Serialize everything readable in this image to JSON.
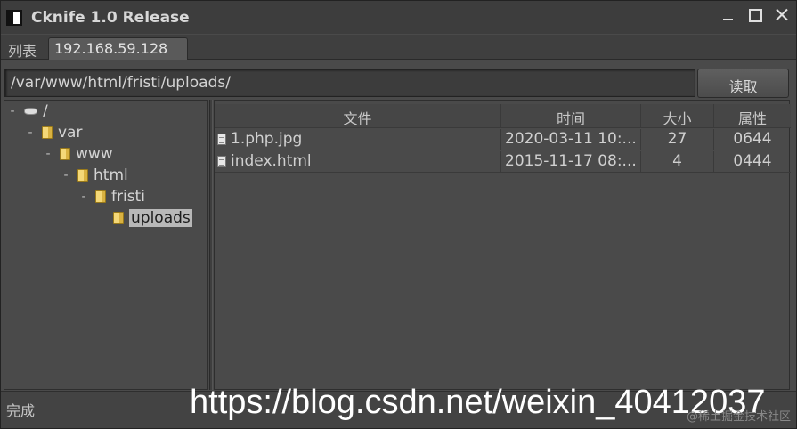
{
  "window": {
    "title": "Cknife 1.0 Release"
  },
  "tabs": [
    {
      "label": "列表"
    },
    {
      "label": "192.168.59.128"
    }
  ],
  "path_bar": {
    "value": "/var/www/html/fristi/uploads/",
    "read_button_label": "读取"
  },
  "tree": {
    "nodes": [
      {
        "label": "/",
        "toggle": "-",
        "icon": "drive-icon"
      },
      {
        "label": "var",
        "toggle": "-",
        "icon": "folder-icon"
      },
      {
        "label": "www",
        "toggle": "-",
        "icon": "folder-icon"
      },
      {
        "label": "html",
        "toggle": "-",
        "icon": "folder-icon"
      },
      {
        "label": "fristi",
        "toggle": "-",
        "icon": "folder-icon"
      },
      {
        "label": "uploads",
        "toggle": "",
        "icon": "folder-icon",
        "selected": true
      }
    ]
  },
  "file_table": {
    "columns": [
      "文件",
      "时间",
      "大小",
      "属性"
    ],
    "rows": [
      {
        "name": "1.php.jpg",
        "time": "2020-03-11 10:...",
        "size": "27",
        "attr": "0644"
      },
      {
        "name": "index.html",
        "time": "2015-11-17 08:...",
        "size": "4",
        "attr": "0444"
      }
    ]
  },
  "status": {
    "text": "完成"
  },
  "watermark": {
    "url": "https://blog.csdn.net/weixin_40412037",
    "small": "@稀土掘金技术社区"
  }
}
